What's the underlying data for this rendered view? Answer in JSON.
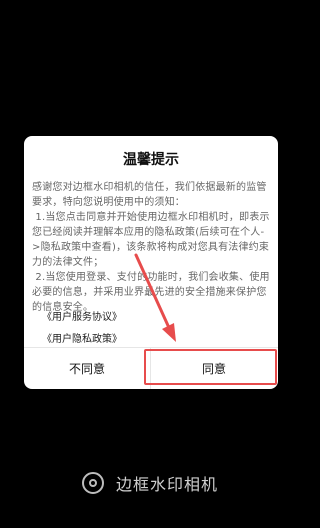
{
  "dialog": {
    "title": "温馨提示",
    "body": [
      "感谢您对边框水印相机的信任，我们依据最新的监管要求，特向您说明使用中的须知：",
      " 1.当您点击同意并开始使用边框水印相机时，即表示您已经阅读并理解本应用的隐私政策(后续可在个人->隐私政策中查看)，该条款将构成对您具有法律约束力的法律文件；",
      " 2.当您使用登录、支付的功能时，我们会收集、使用必要的信息，并采用业界最先进的安全措施来保护您的信息安全。"
    ],
    "links": {
      "user_agreement": "《用户服务协议》",
      "privacy_policy": "《用户隐私政策》"
    },
    "buttons": {
      "disagree": "不同意",
      "agree": "同意"
    }
  },
  "app": {
    "name": "边框水印相机",
    "icon": "camera-lens-icon"
  },
  "colors": {
    "annotation": "#e74c4c",
    "background": "#000000"
  }
}
